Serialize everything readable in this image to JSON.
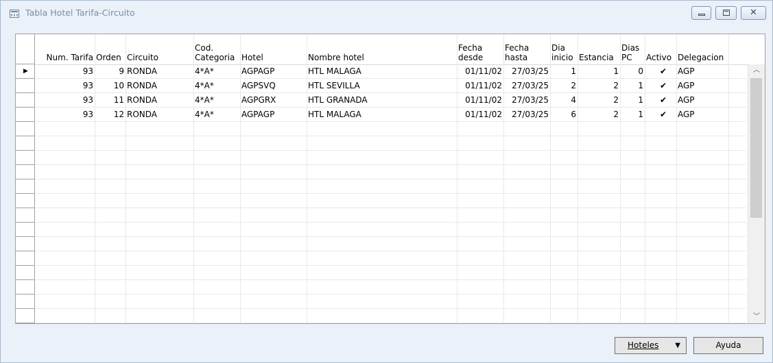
{
  "window": {
    "title": "Tabla Hotel Tarifa-Circuito"
  },
  "columns": [
    {
      "label": "Num. Tarifa"
    },
    {
      "label": "Orden"
    },
    {
      "label": "Circuito"
    },
    {
      "label": "Cod.\nCategoria"
    },
    {
      "label": "Hotel"
    },
    {
      "label": "Nombre hotel"
    },
    {
      "label": "Fecha\ndesde"
    },
    {
      "label": "Fecha\nhasta"
    },
    {
      "label": "Dia\ninicio"
    },
    {
      "label": "Estancia"
    },
    {
      "label": "Dias\nPC"
    },
    {
      "label": "Activo"
    },
    {
      "label": "Delegacion"
    }
  ],
  "rows": [
    {
      "tarifa": "93",
      "orden": "9",
      "circuito": "RONDA",
      "categoria": "4*A*",
      "hotel": "AGPAGP",
      "nombre": "HTL MALAGA",
      "desde": "01/11/02",
      "hasta": "27/03/25",
      "inicio": "1",
      "estancia": "1",
      "pc": "0",
      "activo": "✔",
      "delegacion": "AGP"
    },
    {
      "tarifa": "93",
      "orden": "10",
      "circuito": "RONDA",
      "categoria": "4*A*",
      "hotel": "AGPSVQ",
      "nombre": "HTL SEVILLA",
      "desde": "01/11/02",
      "hasta": "27/03/25",
      "inicio": "2",
      "estancia": "2",
      "pc": "1",
      "activo": "✔",
      "delegacion": "AGP"
    },
    {
      "tarifa": "93",
      "orden": "11",
      "circuito": "RONDA",
      "categoria": "4*A*",
      "hotel": "AGPGRX",
      "nombre": "HTL GRANADA",
      "desde": "01/11/02",
      "hasta": "27/03/25",
      "inicio": "4",
      "estancia": "2",
      "pc": "1",
      "activo": "✔",
      "delegacion": "AGP"
    },
    {
      "tarifa": "93",
      "orden": "12",
      "circuito": "RONDA",
      "categoria": "4*A*",
      "hotel": "AGPAGP",
      "nombre": "HTL MALAGA",
      "desde": "01/11/02",
      "hasta": "27/03/25",
      "inicio": "6",
      "estancia": "2",
      "pc": "1",
      "activo": "✔",
      "delegacion": "AGP"
    }
  ],
  "buttons": {
    "hoteles": "Hoteles",
    "ayuda": "Ayuda"
  },
  "icons": {
    "current_row": "row-pointer-icon",
    "check": "check-icon"
  }
}
